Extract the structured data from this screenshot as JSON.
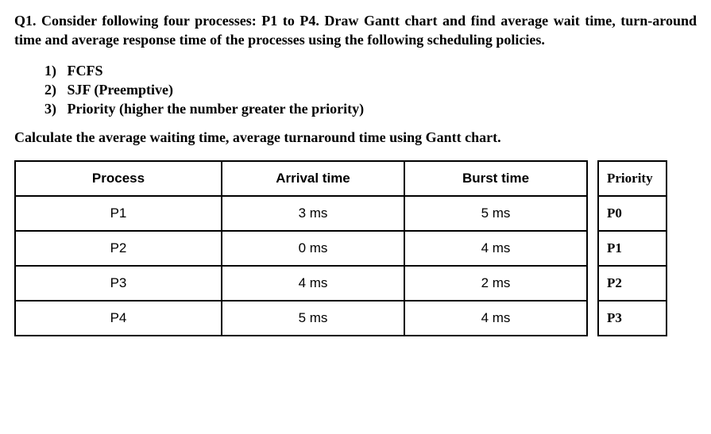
{
  "question": "Q1. Consider following four processes: P1 to P4. Draw Gantt chart and find average wait time, turn-around time and average response time of the processes using the following scheduling policies.",
  "policies": [
    {
      "num": "1)",
      "text": "FCFS"
    },
    {
      "num": "2)",
      "text": "SJF (Preemptive)"
    },
    {
      "num": "3)",
      "text": "Priority (higher the number greater the priority)"
    }
  ],
  "instruction": "Calculate the average waiting time, average turnaround time using Gantt chart.",
  "main_table": {
    "headers": [
      "Process",
      "Arrival time",
      "Burst time"
    ],
    "rows": [
      [
        "P1",
        "3 ms",
        "5 ms"
      ],
      [
        "P2",
        "0 ms",
        "4 ms"
      ],
      [
        "P3",
        "4 ms",
        "2 ms"
      ],
      [
        "P4",
        "5 ms",
        "4 ms"
      ]
    ]
  },
  "prio_table": {
    "header": "Priority",
    "rows": [
      "P0",
      "P1",
      "P2",
      "P3"
    ]
  }
}
